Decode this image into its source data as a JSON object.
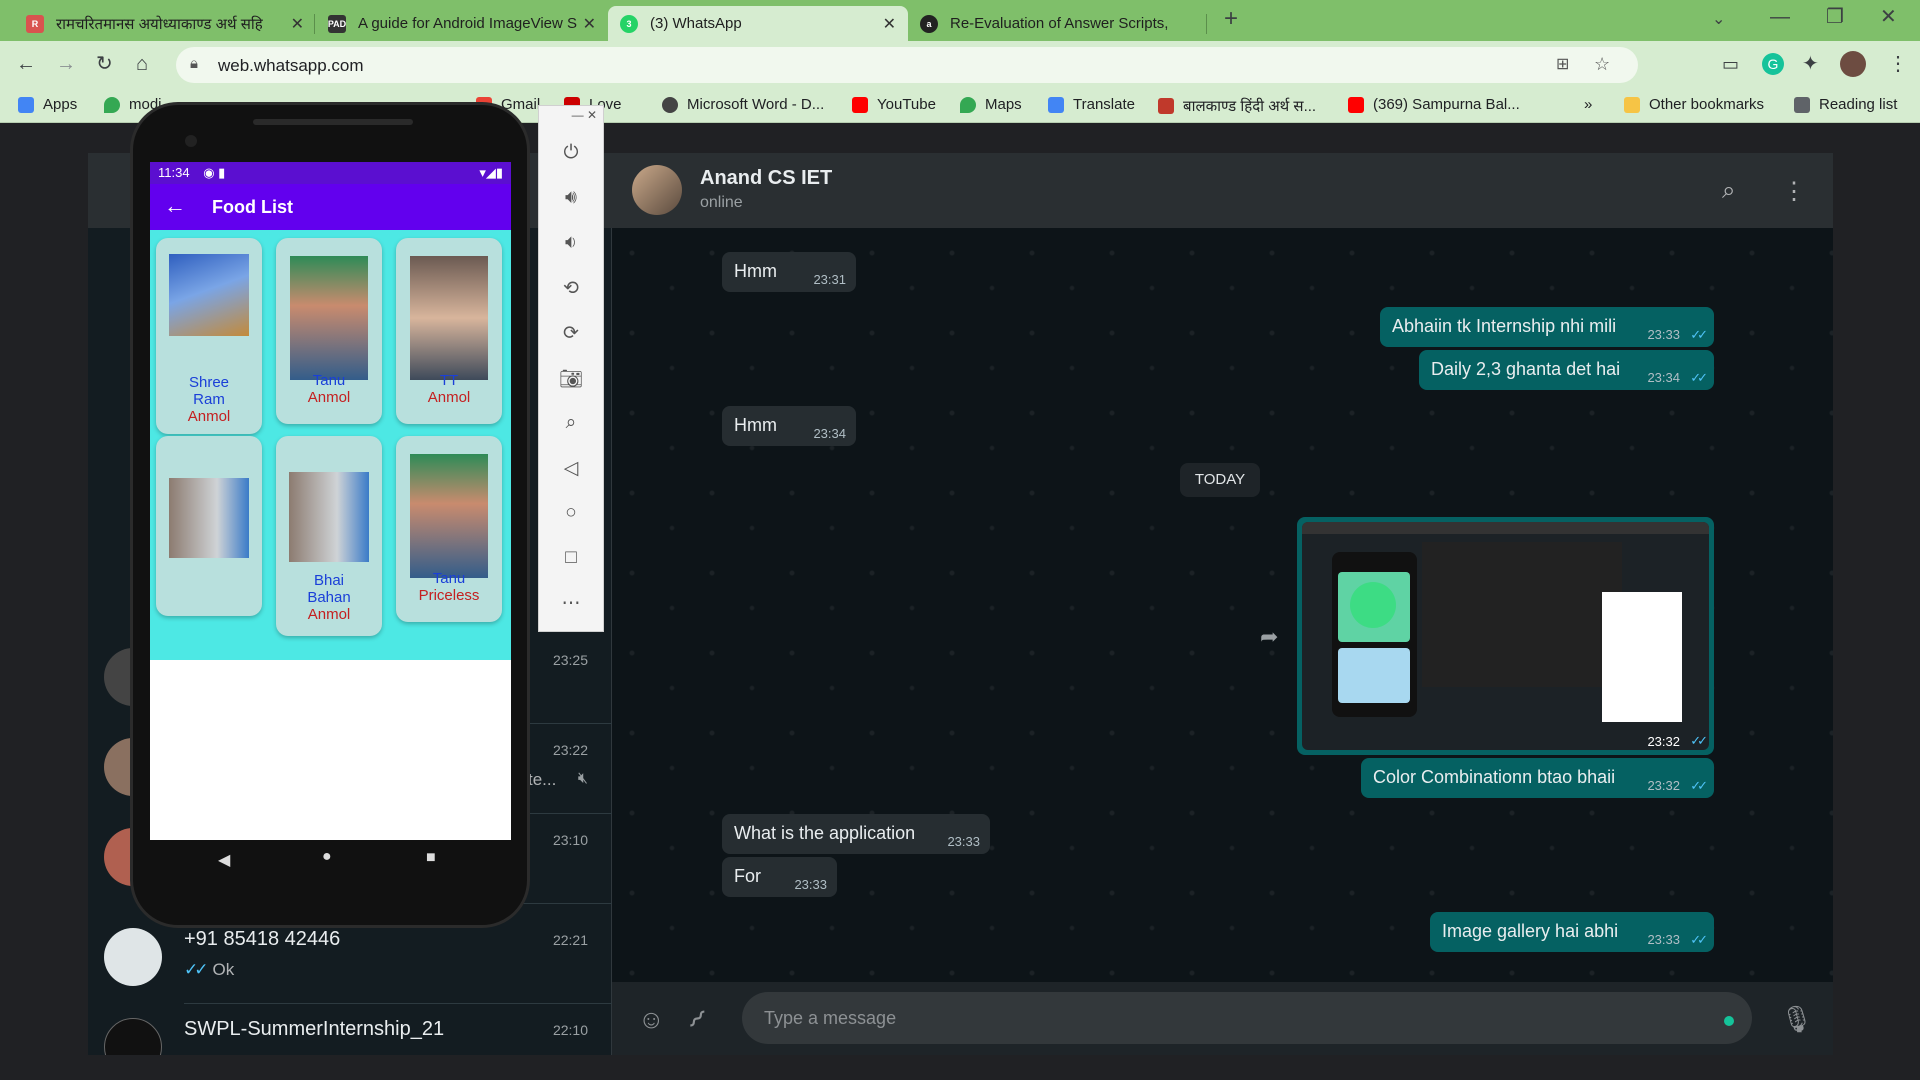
{
  "browser": {
    "tabs": [
      {
        "title": "रामचरितमानस अयोध्याकाण्ड अर्थ सहि",
        "active": false,
        "fav_color": "#d9534f"
      },
      {
        "title": "A guide for Android ImageView S",
        "active": false,
        "fav_color": "#333"
      },
      {
        "title": "(3) WhatsApp",
        "active": true,
        "fav_color": "#25d366"
      },
      {
        "title": "Re-Evaluation of Answer Scripts,",
        "active": false,
        "fav_color": "#222"
      }
    ],
    "new_tab": "+",
    "url": "web.whatsapp.com",
    "bookmarks": [
      {
        "label": "Apps",
        "color": "#4285f4"
      },
      {
        "label": "modi...",
        "color": "#34a853"
      },
      {
        "label": "Gmail",
        "color": "#ea4335"
      },
      {
        "label": "Love",
        "color": "#c00"
      },
      {
        "label": "Microsoft Word - D...",
        "color": "#444"
      },
      {
        "label": "YouTube",
        "color": "#ff0000"
      },
      {
        "label": "Maps",
        "color": "#34a853"
      },
      {
        "label": "Translate",
        "color": "#4285f4"
      },
      {
        "label": "बालकाण्ड हिंदी अर्थ स...",
        "color": "#c0392b"
      },
      {
        "label": "(369) Sampurna Bal...",
        "color": "#ff0000"
      }
    ],
    "more_bookmarks": "»",
    "other_bookmarks": "Other bookmarks",
    "reading_list": "Reading list"
  },
  "chat_list": {
    "rows": [
      {
        "name": "",
        "time": "23:25",
        "preview": ""
      },
      {
        "name": "",
        "time": "23:22",
        "preview": "te..."
      },
      {
        "name": "",
        "time": "23:10",
        "preview": ""
      },
      {
        "name": "+91 85418 42446",
        "time": "22:21",
        "preview": "Ok"
      },
      {
        "name": "SWPL-SummerInternship_21",
        "time": "22:10",
        "preview": ""
      }
    ]
  },
  "chat": {
    "contact_name": "Anand CS IET",
    "status": "online",
    "messages": [
      {
        "dir": "in",
        "text": "Hmm",
        "time": "23:31"
      },
      {
        "dir": "out",
        "text": "Abhaiin tk Internship nhi mili",
        "time": "23:33"
      },
      {
        "dir": "out",
        "text": "Daily 2,3 ghanta det hai",
        "time": "23:34"
      },
      {
        "dir": "in",
        "text": "Hmm",
        "time": "23:34"
      },
      {
        "dir": "out",
        "text": "Color Combinationn btao bhaii",
        "time": "23:32"
      },
      {
        "dir": "in",
        "text": "What is the application",
        "time": "23:33"
      },
      {
        "dir": "in",
        "text": "For",
        "time": "23:33"
      },
      {
        "dir": "out",
        "text": "Image gallery hai abhi",
        "time": "23:33"
      }
    ],
    "day_chip": "TODAY",
    "image_time": "23:32",
    "compose_placeholder": "Type a message"
  },
  "emulator": {
    "status_time": "11:34",
    "app_title": "Food List",
    "cards": [
      {
        "line1": "Shree",
        "line2": "Ram",
        "line3": "Anmol"
      },
      {
        "line1": "Tanu",
        "line2": "",
        "line3": "Anmol"
      },
      {
        "line1": "TT",
        "line2": "",
        "line3": "Anmol"
      },
      {
        "line1": "",
        "line2": "",
        "line3": ""
      },
      {
        "line1": "Bhai",
        "line2": "Bahan",
        "line3": "Anmol"
      },
      {
        "line1": "Tanu",
        "line2": "",
        "line3": "Priceless"
      }
    ]
  }
}
